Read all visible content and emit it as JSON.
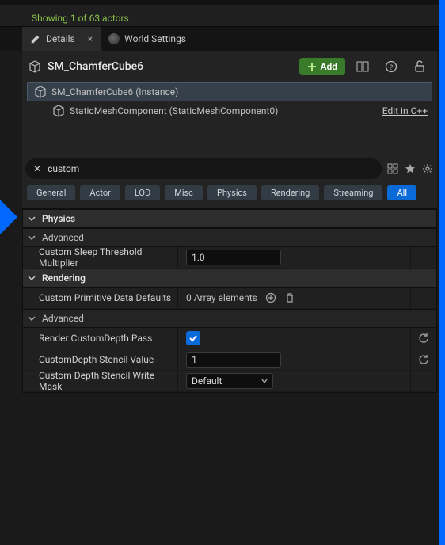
{
  "status": "Showing 1 of 63 actors",
  "tabs": {
    "details": "Details",
    "world_settings": "World Settings"
  },
  "header": {
    "actor_name": "SM_ChamferCube6",
    "add_label": "Add"
  },
  "outliner": {
    "instance": "SM_ChamferCube6 (Instance)",
    "component": "StaticMeshComponent (StaticMeshComponent0)",
    "edit_link": "Edit in C++"
  },
  "search": {
    "value": "custom"
  },
  "filters": [
    "General",
    "Actor",
    "LOD",
    "Misc",
    "Physics",
    "Rendering",
    "Streaming",
    "All"
  ],
  "active_filter": "All",
  "sections": {
    "physics": {
      "title": "Physics",
      "advanced": "Advanced",
      "sleep_label": "Custom Sleep Threshold Multiplier",
      "sleep_value": "1.0"
    },
    "rendering": {
      "title": "Rendering",
      "cpd_label": "Custom Primitive Data Defaults",
      "cpd_value": "0 Array elements",
      "advanced": "Advanced",
      "rcd_label": "Render CustomDepth Pass",
      "rcd_value": true,
      "csv_label": "CustomDepth Stencil Value",
      "csv_value": "1",
      "mask_label": "Custom Depth Stencil Write Mask",
      "mask_value": "Default"
    }
  }
}
